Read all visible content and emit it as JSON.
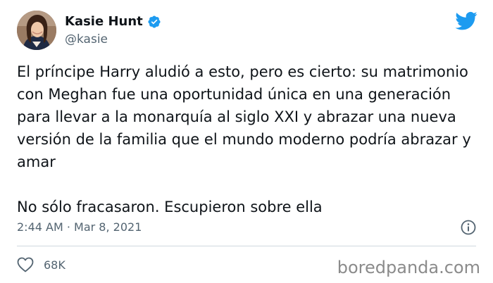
{
  "author": {
    "display_name": "Kasie Hunt",
    "handle": "@kasie",
    "verified": true,
    "avatar_icon": "profile-photo"
  },
  "header": {
    "logo_icon": "twitter-bird-icon",
    "logo_color": "#1d9bf0"
  },
  "tweet": {
    "paragraph_1": "El príncipe Harry aludió a esto, pero es cierto: su matrimonio con Meghan fue una oportunidad única en una generación para llevar a la monarquía al siglo XXI y abrazar una nueva versión de la familia que el mundo moderno podría abrazar y amar",
    "paragraph_2": "No sólo fracasaron. Escupieron sobre ella"
  },
  "meta": {
    "timestamp": "2:44 AM · Mar 8, 2021",
    "info_icon": "info-icon"
  },
  "engagement": {
    "like_icon": "heart-icon",
    "likes": "68K"
  },
  "watermark": {
    "text": "boredpanda.com"
  },
  "colors": {
    "text": "#0f1419",
    "secondary_text": "#536471",
    "verified_badge": "#1d9bf0",
    "divider": "#cfd9de",
    "watermark": "#8b8b8b"
  }
}
